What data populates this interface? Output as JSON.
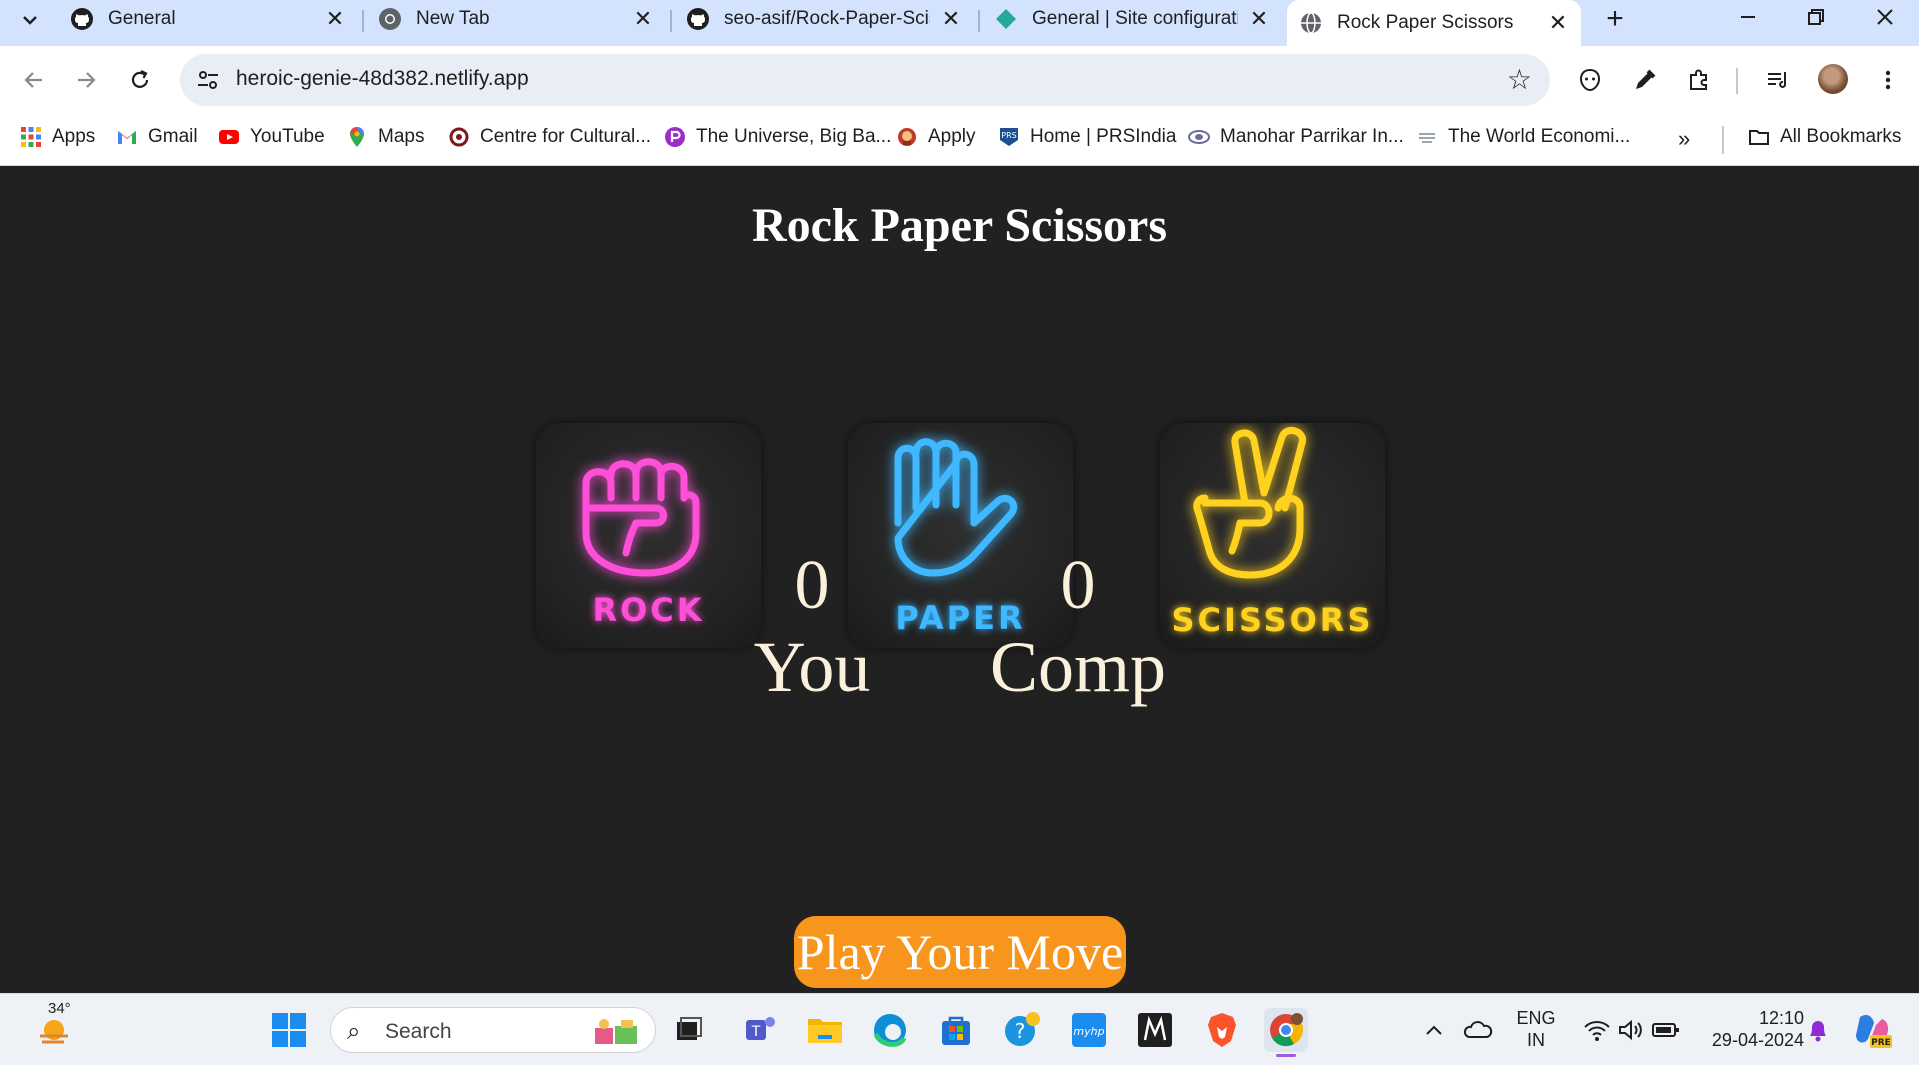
{
  "browser": {
    "tabs": [
      {
        "title": "General",
        "icon": "github-icon",
        "active": false
      },
      {
        "title": "New Tab",
        "icon": "chrome-icon",
        "active": false
      },
      {
        "title": "seo-asif/Rock-Paper-Scis",
        "icon": "github-icon",
        "active": false
      },
      {
        "title": "General | Site configurati",
        "icon": "netlify-icon",
        "active": false
      },
      {
        "title": "Rock Paper Scissors",
        "icon": "globe-icon",
        "active": true
      }
    ],
    "url": "heroic-genie-48d382.netlify.app",
    "bookmarks": [
      {
        "label": "Apps",
        "icon": "apps-grid-icon"
      },
      {
        "label": "Gmail",
        "icon": "gmail-icon"
      },
      {
        "label": "YouTube",
        "icon": "youtube-icon"
      },
      {
        "label": "Maps",
        "icon": "maps-icon"
      },
      {
        "label": "Centre for Cultural...",
        "icon": "ccrt-icon"
      },
      {
        "label": "The Universe, Big Ba...",
        "icon": "pocket-icon"
      },
      {
        "label": "Apply",
        "icon": "emblem-icon"
      },
      {
        "label": "Home | PRSIndia",
        "icon": "prs-icon"
      },
      {
        "label": "Manohar Parrikar In...",
        "icon": "idsa-icon"
      },
      {
        "label": "The World Economi...",
        "icon": "wef-icon"
      }
    ],
    "all_bookmarks_label": "All Bookmarks"
  },
  "page": {
    "title": "Rock Paper Scissors",
    "choices": [
      {
        "label": "ROCK",
        "color": "#ff4fd8",
        "icon": "fist-icon"
      },
      {
        "label": "PAPER",
        "color": "#3fb8ff",
        "icon": "open-hand-icon"
      },
      {
        "label": "SCISSORS",
        "color": "#ffd21f",
        "icon": "peace-sign-icon"
      }
    ],
    "user_score": "0",
    "user_label": "You",
    "comp_score": "0",
    "comp_label": "Comp",
    "message": "Play Your Move",
    "message_bg": "#f7951d"
  },
  "taskbar": {
    "weather_temp": "34°",
    "search_placeholder": "Search",
    "language_line1": "ENG",
    "language_line2": "IN",
    "time": "12:10",
    "date": "29-04-2024"
  }
}
